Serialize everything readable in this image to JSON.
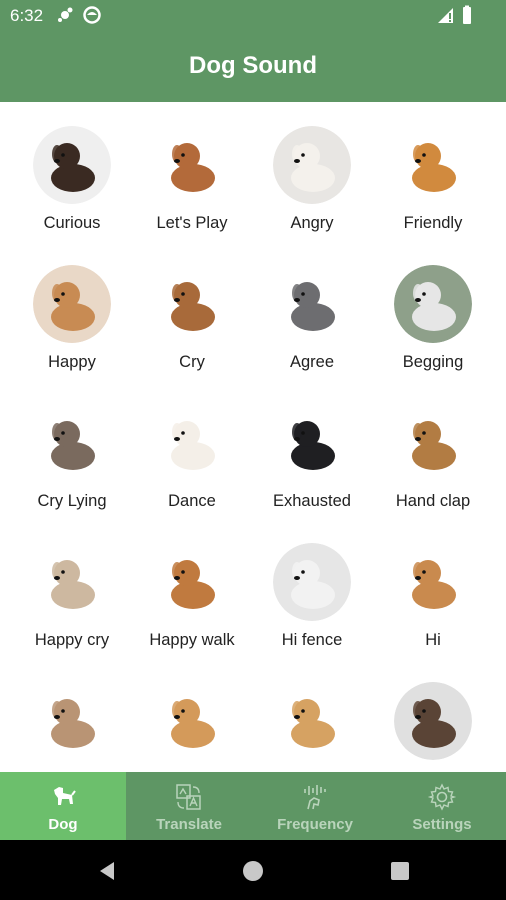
{
  "status": {
    "time": "6:32"
  },
  "header": {
    "title": "Dog Sound"
  },
  "sounds": [
    {
      "label": "Curious",
      "coat": "#3a2a22",
      "bg": "#efefef"
    },
    {
      "label": "Let's Play",
      "coat": "#b36a3a",
      "bg": "#ffffff"
    },
    {
      "label": "Angry",
      "coat": "#f4f1ec",
      "bg": "#e8e6e3"
    },
    {
      "label": "Friendly",
      "coat": "#d18a3e",
      "bg": "#ffffff"
    },
    {
      "label": "Happy",
      "coat": "#c88b53",
      "bg": "#e9d8c7"
    },
    {
      "label": "Cry",
      "coat": "#a86a3a",
      "bg": "#ffffff"
    },
    {
      "label": "Agree",
      "coat": "#6d6d70",
      "bg": "#ffffff"
    },
    {
      "label": "Begging",
      "coat": "#e6e6e6",
      "bg": "#8ea08a"
    },
    {
      "label": "Cry Lying",
      "coat": "#7a6a5e",
      "bg": "#ffffff"
    },
    {
      "label": "Dance",
      "coat": "#f4efe8",
      "bg": "#ffffff"
    },
    {
      "label": "Exhausted",
      "coat": "#1f1f22",
      "bg": "#ffffff"
    },
    {
      "label": "Hand clap",
      "coat": "#b27c43",
      "bg": "#ffffff"
    },
    {
      "label": "Happy cry",
      "coat": "#cdb8a0",
      "bg": "#ffffff"
    },
    {
      "label": "Happy walk",
      "coat": "#c07a3f",
      "bg": "#ffffff"
    },
    {
      "label": "Hi fence",
      "coat": "#f2f2f2",
      "bg": "#e6e6e6"
    },
    {
      "label": "Hi",
      "coat": "#c98a4e",
      "bg": "#ffffff"
    },
    {
      "label": "",
      "coat": "#b99474",
      "bg": "#ffffff"
    },
    {
      "label": "",
      "coat": "#d49a5a",
      "bg": "#ffffff"
    },
    {
      "label": "",
      "coat": "#d6a262",
      "bg": "#ffffff"
    },
    {
      "label": "",
      "coat": "#5a4436",
      "bg": "#e0e0e0"
    }
  ],
  "nav": [
    {
      "label": "Dog",
      "icon": "dog-icon",
      "active": true
    },
    {
      "label": "Translate",
      "icon": "translate-icon",
      "active": false
    },
    {
      "label": "Frequency",
      "icon": "frequency-icon",
      "active": false
    },
    {
      "label": "Settings",
      "icon": "gear-icon",
      "active": false
    }
  ],
  "colors": {
    "primary": "#5e9664",
    "active_tab": "#6cbf6c"
  }
}
